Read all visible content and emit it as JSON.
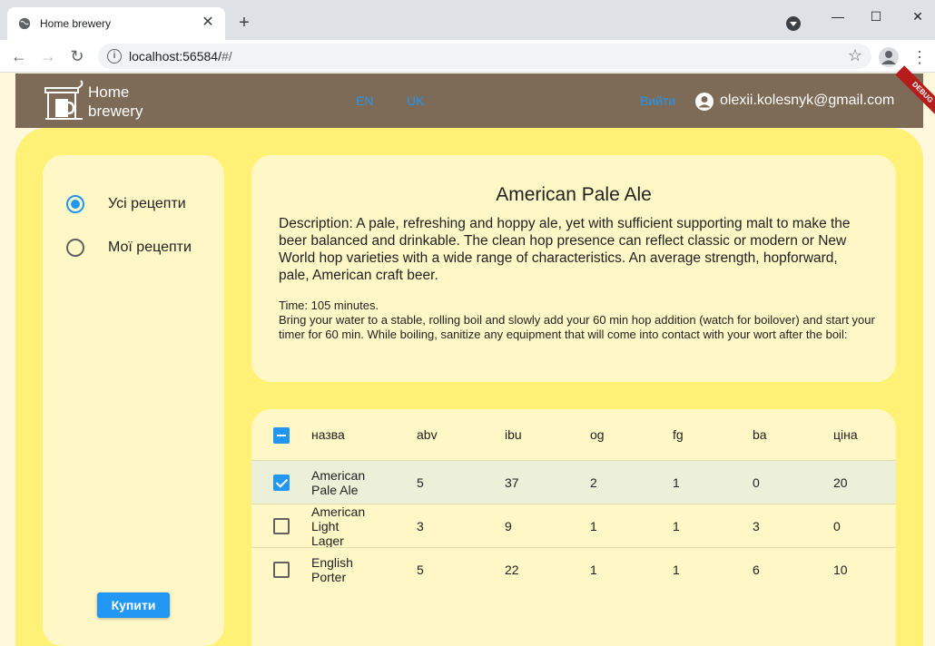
{
  "browser": {
    "tab_title": "Home brewery",
    "new_tab": "+",
    "tab_close": "✕",
    "url_host": "localhost:56584/",
    "url_path": "#/",
    "window_min": "—",
    "window_max": "☐",
    "window_close": "✕"
  },
  "appbar": {
    "brand_line1": "Home",
    "brand_line2": "brewery",
    "lang_en": "EN",
    "lang_uk": "UK",
    "login": "Вийти",
    "user_email": "olexii.kolesnyk@gmail.com",
    "debug_banner": "DEBUG"
  },
  "sidebar": {
    "options": [
      {
        "label": "Усі рецепти",
        "selected": true
      },
      {
        "label": "Мої рецепти",
        "selected": false
      }
    ],
    "buy_button": "Купити"
  },
  "recipe": {
    "title": "American Pale Ale",
    "description": "Description: A pale, refreshing and hoppy ale, yet with sufficient supporting malt to make the beer balanced and drinkable. The clean hop presence can reflect classic or modern or New World hop varieties with a wide range of characteristics. An average strength, hopforward, pale, American craft beer.",
    "time": "Time: 105 minutes.",
    "instructions": "Bring your water to a stable, rolling boil and slowly add your 60 min hop addition (watch for boilover) and start your timer for 60 min. While boiling, sanitize any equipment that will come into contact with your wort after the boil:"
  },
  "table": {
    "columns": [
      "назва",
      "abv",
      "ibu",
      "og",
      "fg",
      "ba",
      "ціна"
    ],
    "rows": [
      {
        "name": "American Pale Ale",
        "abv": "5",
        "ibu": "37",
        "og": "2",
        "fg": "1",
        "ba": "0",
        "price": "20",
        "checked": true
      },
      {
        "name": "American Light Lager",
        "abv": "3",
        "ibu": "9",
        "og": "1",
        "fg": "1",
        "ba": "3",
        "price": "0",
        "checked": false
      },
      {
        "name": "English Porter",
        "abv": "5",
        "ibu": "22",
        "og": "1",
        "fg": "1",
        "ba": "6",
        "price": "10",
        "checked": false
      }
    ]
  },
  "colors": {
    "appbar": "#7d6a57",
    "content_bg": "#fff176",
    "card_bg": "#fff8c6",
    "accent": "#2196f3"
  }
}
